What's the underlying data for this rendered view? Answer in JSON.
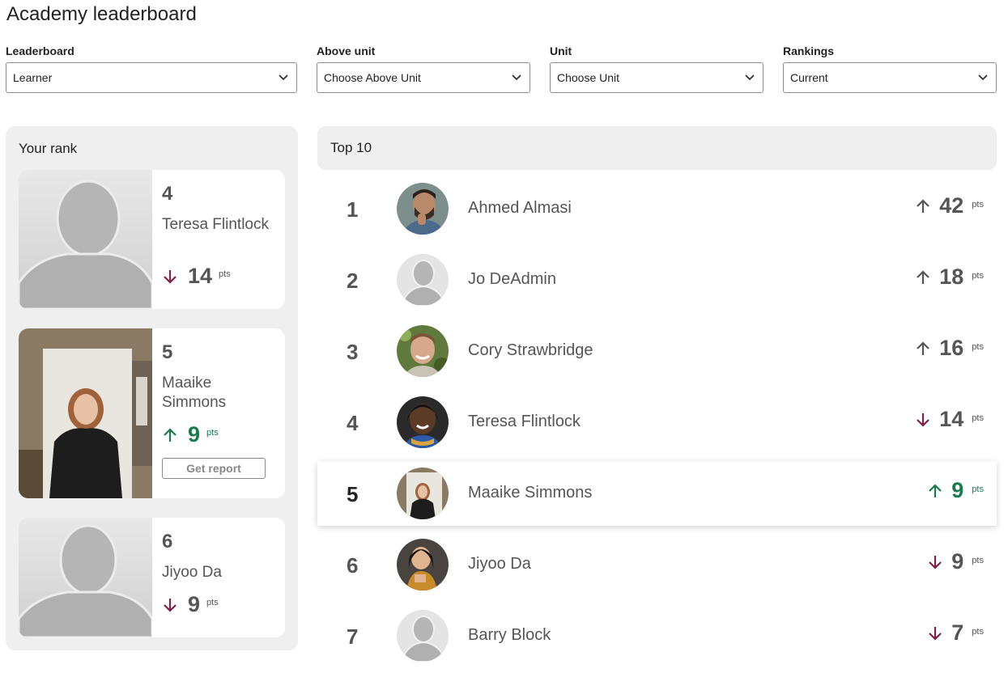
{
  "title": "Academy leaderboard",
  "filters": [
    {
      "label": "Leaderboard",
      "value": "Learner"
    },
    {
      "label": "Above unit",
      "value": "Choose Above Unit"
    },
    {
      "label": "Unit",
      "value": "Choose Unit"
    },
    {
      "label": "Rankings",
      "value": "Current"
    }
  ],
  "your_rank": {
    "title": "Your rank",
    "cards": [
      {
        "rank": "4",
        "name": "Teresa Flintlock",
        "trend": "down",
        "points": "14",
        "pts_label": "pts"
      },
      {
        "rank": "5",
        "name": "Maaike Simmons",
        "trend": "up",
        "points": "9",
        "pts_label": "pts",
        "button": "Get report"
      },
      {
        "rank": "6",
        "name": "Jiyoo Da",
        "trend": "down",
        "points": "9",
        "pts_label": "pts"
      }
    ]
  },
  "top": {
    "title": "Top 10",
    "rows": [
      {
        "rank": "1",
        "name": "Ahmed Almasi",
        "trend": "up",
        "points": "42",
        "pts_label": "pts"
      },
      {
        "rank": "2",
        "name": "Jo DeAdmin",
        "trend": "up",
        "points": "18",
        "pts_label": "pts"
      },
      {
        "rank": "3",
        "name": "Cory Strawbridge",
        "trend": "up",
        "points": "16",
        "pts_label": "pts"
      },
      {
        "rank": "4",
        "name": "Teresa Flintlock",
        "trend": "down",
        "points": "14",
        "pts_label": "pts"
      },
      {
        "rank": "5",
        "name": "Maaike Simmons",
        "trend": "up",
        "points": "9",
        "pts_label": "pts",
        "current_user": true
      },
      {
        "rank": "6",
        "name": "Jiyoo Da",
        "trend": "down",
        "points": "9",
        "pts_label": "pts"
      },
      {
        "rank": "7",
        "name": "Barry Block",
        "trend": "down",
        "points": "7",
        "pts_label": "pts"
      }
    ]
  },
  "colors": {
    "up_neutral": "#555555",
    "up_current": "#1a7a4c",
    "down": "#7d2148",
    "panel_bg": "#efefef"
  },
  "icons": {
    "up": "arrow-up-icon",
    "down": "arrow-down-icon",
    "select": "chevron-down-icon"
  }
}
